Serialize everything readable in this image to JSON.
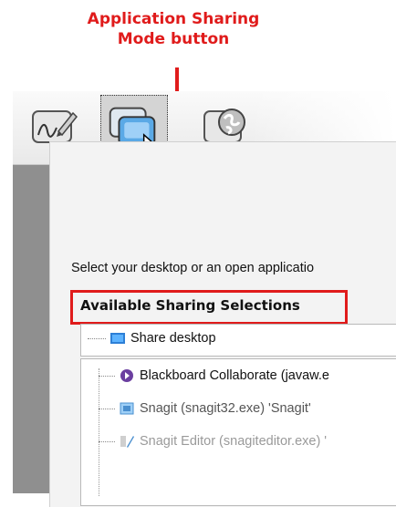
{
  "callout": {
    "line1": "Application Sharing",
    "line2": "Mode button",
    "color": "#e01b1b"
  },
  "toolbar": {
    "buttons": [
      {
        "icon": "whiteboard-draw-icon",
        "selected": false
      },
      {
        "icon": "application-sharing-icon",
        "selected": true
      },
      {
        "icon": "web-tour-icon",
        "selected": false
      }
    ]
  },
  "dialog": {
    "instruction": "Select your desktop or an open applicatio",
    "section_title": "Available Sharing Selections",
    "share_desktop": {
      "label": "Share desktop",
      "icon": "desktop-icon"
    },
    "applications": [
      {
        "label": "Blackboard Collaborate (javaw.e",
        "icon": "collaborate-icon"
      },
      {
        "label": "Snagit (snagit32.exe) 'Snagit'",
        "icon": "snagit-icon"
      },
      {
        "label": "Snagit Editor (snagiteditor.exe) '",
        "icon": "snagit-editor-icon"
      }
    ]
  }
}
